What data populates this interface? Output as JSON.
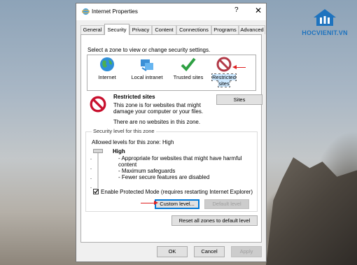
{
  "watermark": {
    "text": "HOCVIENIT.VN",
    "brand_color": "#1e73be"
  },
  "window": {
    "title": "Internet Properties",
    "help_glyph": "?",
    "close_glyph": "✕"
  },
  "tabs": [
    {
      "label": "General"
    },
    {
      "label": "Security",
      "active": true
    },
    {
      "label": "Privacy"
    },
    {
      "label": "Content"
    },
    {
      "label": "Connections"
    },
    {
      "label": "Programs"
    },
    {
      "label": "Advanced"
    }
  ],
  "security": {
    "prompt": "Select a zone to view or change security settings.",
    "zones": [
      {
        "label": "Internet",
        "icon": "globe-icon"
      },
      {
        "label": "Local intranet",
        "icon": "network-icon"
      },
      {
        "label": "Trusted sites",
        "icon": "checkmark-icon"
      },
      {
        "label": "Restricted sites",
        "icon": "no-entry-icon",
        "selected": true
      }
    ],
    "zone_title": "Restricted sites",
    "zone_desc_line1": "This zone is for websites that might",
    "zone_desc_line2": "damage your computer or your files.",
    "zone_empty": "There are no websites in this zone.",
    "sites_button": "Sites"
  },
  "level": {
    "group_label": "Security level for this zone",
    "allowed": "Allowed levels for this zone: High",
    "name": "High",
    "bullets": [
      "- Appropriate for websites that might have harmful",
      "  content",
      "- Maximum safeguards",
      "- Fewer secure features are disabled"
    ],
    "protected_mode": "Enable Protected Mode (requires restarting Internet Explorer)",
    "protected_checked": true,
    "custom_button": "Custom level...",
    "default_button": "Default level",
    "reset_button": "Reset all zones to default level"
  },
  "footer": {
    "ok": "OK",
    "cancel": "Cancel",
    "apply": "Apply"
  },
  "colors": {
    "annotation_arrow": "#e02020",
    "selection": "#cce8ff",
    "focus": "#0078d7"
  }
}
